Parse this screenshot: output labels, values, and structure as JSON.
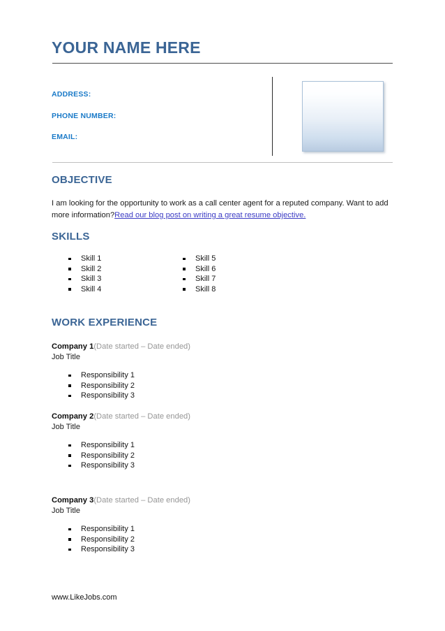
{
  "document": {
    "name_title": "YOUR NAME HERE",
    "footer_url": "www.LikeJobs.com",
    "accent_heading_color": "#3b6595",
    "contact_label_color": "#1a7ac8",
    "link_color": "#3b3bc4",
    "date_text_color": "#969696"
  },
  "contact": {
    "address_label": "ADDRESS:",
    "phone_label": "PHONE NUMBER:",
    "email_label": "EMAIL:"
  },
  "photo": {
    "alt": "photo-placeholder"
  },
  "objective": {
    "heading": "OBJECTIVE",
    "body_before_link": "I am looking for the opportunity to work as a call center agent for a reputed company. Want to add more information?",
    "link_text": "Read our blog post on writing a great resume objective."
  },
  "skills": {
    "heading": "SKILLS",
    "column_1": [
      "Skill 1",
      "Skill 2",
      "Skill 3",
      "Skill 4"
    ],
    "column_2": [
      "Skill 5",
      "Skill 6",
      "Skill 7",
      "Skill 8"
    ]
  },
  "work_experience": {
    "heading": "WORK EXPERIENCE",
    "jobs": [
      {
        "company": "Company 1",
        "dates": "(Date started – Date ended)",
        "title": "Job Title",
        "responsibilities": [
          "Responsibility 1",
          "Responsibility 2",
          "Responsibility 3"
        ]
      },
      {
        "company": "Company 2",
        "dates": "(Date started – Date ended)",
        "title": "Job Title",
        "responsibilities": [
          "Responsibility 1",
          "Responsibility 2",
          "Responsibility 3"
        ]
      },
      {
        "company": "Company 3",
        "dates": "(Date started – Date ended)",
        "title": "Job Title",
        "responsibilities": [
          "Responsibility 1",
          "Responsibility 2",
          "Responsibility 3"
        ]
      }
    ]
  }
}
